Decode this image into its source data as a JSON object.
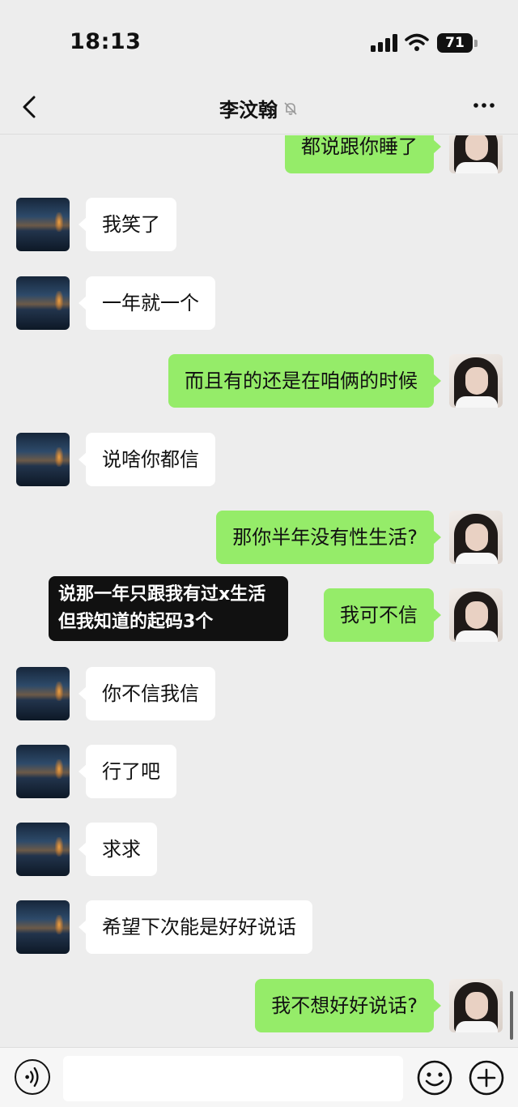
{
  "status_bar": {
    "time": "18:13",
    "battery": "71"
  },
  "header": {
    "title": "李汶翰",
    "back_icon": "chevron-left-icon",
    "mute_icon": "bell-off-icon",
    "more_icon": "more-dots-icon"
  },
  "messages": [
    {
      "side": "right",
      "text": "都说跟你睡了"
    },
    {
      "side": "left",
      "text": "我笑了"
    },
    {
      "side": "left",
      "text": "一年就一个"
    },
    {
      "side": "right",
      "text": "而且有的还是在咱俩的时候"
    },
    {
      "side": "left",
      "text": "说啥你都信"
    },
    {
      "side": "right",
      "text": "那你半年没有性生活?"
    },
    {
      "side": "right",
      "text": "我可不信"
    },
    {
      "side": "left",
      "text": "你不信我信"
    },
    {
      "side": "left",
      "text": "行了吧"
    },
    {
      "side": "left",
      "text": "求求"
    },
    {
      "side": "left",
      "text": "希望下次能是好好说话"
    },
    {
      "side": "right",
      "text": "我不想好好说话?"
    }
  ],
  "overlay_caption": "说那一年只跟我有过x生活 但我知道的起码3个",
  "input_bar": {
    "placeholder": "",
    "voice_icon": "voice-icon",
    "emoji_icon": "emoji-icon",
    "plus_icon": "plus-icon"
  }
}
